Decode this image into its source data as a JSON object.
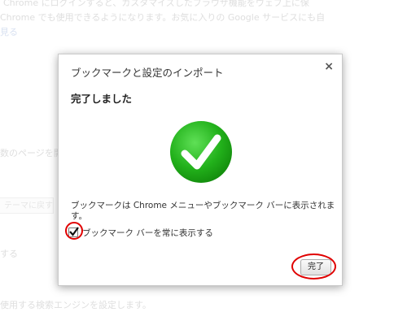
{
  "background": {
    "lines": [
      "Chrome にログインすると、カスタマイズしたブラウザ機能をウェブ上に保",
      "Chrome でも使用できるようになります。お気に入りの Google サービスにも自",
      "見る",
      "数のページを開く",
      "テーマに戻す",
      "する",
      "使用する検索エンジンを設定します。"
    ]
  },
  "dialog": {
    "title": "ブックマークと設定のインポート",
    "close_glyph": "×",
    "heading": "完了しました",
    "message": "ブックマークは Chrome メニューやブックマーク バーに表示されます。",
    "checkbox": {
      "label": "ブックマーク バーを常に表示する",
      "checked": true
    },
    "done_button": "完了"
  },
  "colors": {
    "success_green": "#22b11b",
    "annotation_red": "#e00000"
  }
}
